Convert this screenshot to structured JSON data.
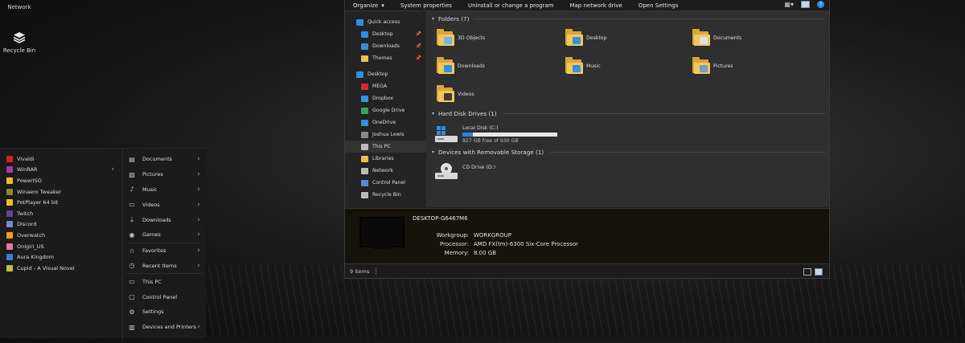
{
  "desktop": {
    "icons": [
      {
        "label": "Network",
        "icon": "network-icon"
      },
      {
        "label": "Recycle Bin",
        "icon": "recycle-bin-icon"
      }
    ]
  },
  "start_menu": {
    "apps": [
      {
        "label": "Vivaldi",
        "color": "#d8202a",
        "has_arrow": false
      },
      {
        "label": "WinRAR",
        "color": "#9c3f9e",
        "has_arrow": true
      },
      {
        "label": "PowerISO",
        "color": "#e8c020",
        "has_arrow": false
      },
      {
        "label": "Winaero Tweaker",
        "color": "#8a8a30",
        "has_arrow": false
      },
      {
        "label": "PotPlayer 64 bit",
        "color": "#f0c020",
        "has_arrow": false
      },
      {
        "label": "Twitch",
        "color": "#6441a4",
        "has_arrow": false
      },
      {
        "label": "Discord",
        "color": "#7289da",
        "has_arrow": false
      },
      {
        "label": "Overwatch",
        "color": "#f99e1a",
        "has_arrow": false
      },
      {
        "label": "Onigiri_US",
        "color": "#e07aa0",
        "has_arrow": false
      },
      {
        "label": "Aura Kingdom",
        "color": "#3a7fd0",
        "has_arrow": false
      },
      {
        "label": "Cupid - A Visual Novel",
        "color": "#c0c040",
        "has_arrow": false
      }
    ],
    "places": [
      {
        "label": "Documents",
        "icon": "documents-icon",
        "glyph": "▤",
        "has_arrow": true
      },
      {
        "label": "Pictures",
        "icon": "pictures-icon",
        "glyph": "▨",
        "has_arrow": true
      },
      {
        "label": "Music",
        "icon": "music-icon",
        "glyph": "♪",
        "has_arrow": true
      },
      {
        "label": "Videos",
        "icon": "videos-icon",
        "glyph": "▭",
        "has_arrow": true
      },
      {
        "label": "Downloads",
        "icon": "downloads-icon",
        "glyph": "⤓",
        "has_arrow": true
      },
      {
        "label": "Games",
        "icon": "games-icon",
        "glyph": "◉",
        "has_arrow": true
      },
      {
        "label": "Favorites",
        "icon": "favorites-icon",
        "glyph": "☆",
        "has_arrow": true
      },
      {
        "label": "Recent Items",
        "icon": "recent-items-icon",
        "glyph": "◷",
        "has_arrow": true
      },
      {
        "label": "This PC",
        "icon": "this-pc-icon",
        "glyph": "▭",
        "has_arrow": false
      },
      {
        "label": "Control Panel",
        "icon": "control-panel-icon",
        "glyph": "▢",
        "has_arrow": false
      },
      {
        "label": "Settings",
        "icon": "settings-icon",
        "glyph": "⚙",
        "has_arrow": false
      },
      {
        "label": "Devices and Printers",
        "icon": "devices-printers-icon",
        "glyph": "▥",
        "has_arrow": true
      }
    ]
  },
  "explorer": {
    "toolbar": [
      {
        "label": "Organize",
        "dropdown": true
      },
      {
        "label": "System properties",
        "dropdown": false
      },
      {
        "label": "Uninstall or change a program",
        "dropdown": false
      },
      {
        "label": "Map network drive",
        "dropdown": false
      },
      {
        "label": "Open Settings",
        "dropdown": false
      }
    ],
    "nav": [
      {
        "label": "Quick access",
        "color": "#2f8fe0",
        "indent": 1,
        "pinned": false
      },
      {
        "label": "Desktop",
        "color": "#2f8fe0",
        "indent": 2,
        "pinned": true
      },
      {
        "label": "Downloads",
        "color": "#2f8fe0",
        "indent": 2,
        "pinned": true
      },
      {
        "label": "Themes",
        "color": "#e9c050",
        "indent": 2,
        "pinned": true
      },
      {
        "label": "",
        "color": "",
        "indent": 0,
        "pinned": false
      },
      {
        "label": "Desktop",
        "color": "#2f8fe0",
        "indent": 1,
        "pinned": false
      },
      {
        "label": "MEGA",
        "color": "#d9272e",
        "indent": 2,
        "pinned": false
      },
      {
        "label": "Dropbox",
        "color": "#3d8fe0",
        "indent": 2,
        "pinned": false
      },
      {
        "label": "Google Drive",
        "color": "#34a853",
        "indent": 2,
        "pinned": false
      },
      {
        "label": "OneDrive",
        "color": "#2f8fe0",
        "indent": 2,
        "pinned": false
      },
      {
        "label": "Joshua Lewis",
        "color": "#888888",
        "indent": 2,
        "pinned": false
      },
      {
        "label": "This PC",
        "color": "#bbbbbb",
        "indent": 2,
        "pinned": false,
        "selected": true
      },
      {
        "label": "Libraries",
        "color": "#e9c050",
        "indent": 2,
        "pinned": false
      },
      {
        "label": "Network",
        "color": "#bbbbbb",
        "indent": 2,
        "pinned": false
      },
      {
        "label": "Control Panel",
        "color": "#4a90d0",
        "indent": 2,
        "pinned": false
      },
      {
        "label": "Recycle Bin",
        "color": "#bbbbbb",
        "indent": 2,
        "pinned": false
      }
    ],
    "groups": {
      "folders": "Folders (7)",
      "drives": "Hard Disk Drives (1)",
      "removable": "Devices with Removable Storage (1)"
    },
    "folders": [
      {
        "label": "3D Objects",
        "badge": "#6fb5e8",
        "col": 0,
        "row": 0
      },
      {
        "label": "Desktop",
        "badge": "#3a8fe0",
        "col": 1,
        "row": 0
      },
      {
        "label": "Documents",
        "badge": "#e0e0e0",
        "col": 2,
        "row": 0
      },
      {
        "label": "Downloads",
        "badge": "#2f8fe0",
        "col": 0,
        "row": 1
      },
      {
        "label": "Music",
        "badge": "#3a8fe0",
        "col": 1,
        "row": 1
      },
      {
        "label": "Pictures",
        "badge": "#6fa0c8",
        "col": 2,
        "row": 1
      },
      {
        "label": "Videos",
        "badge": "#3a3a3a",
        "col": 0,
        "row": 2
      }
    ],
    "drive": {
      "label": "Local Disk (C:)",
      "free_text": "827 GB free of 930 GB",
      "used_fraction": 0.111
    },
    "cd_drive": {
      "label": "CD Drive (D:)"
    },
    "details": {
      "computer_name": "DESKTOP-G6467M6",
      "rows": [
        {
          "label": "Workgroup:",
          "value": "WORKGROUP"
        },
        {
          "label": "Processor:",
          "value": "AMD FX(tm)-6300 Six-Core Processor"
        },
        {
          "label": "Memory:",
          "value": "8.00 GB"
        }
      ]
    },
    "status": {
      "count": "9 items"
    },
    "chevron_glyph": "▾",
    "pin_glyph": "📌"
  }
}
